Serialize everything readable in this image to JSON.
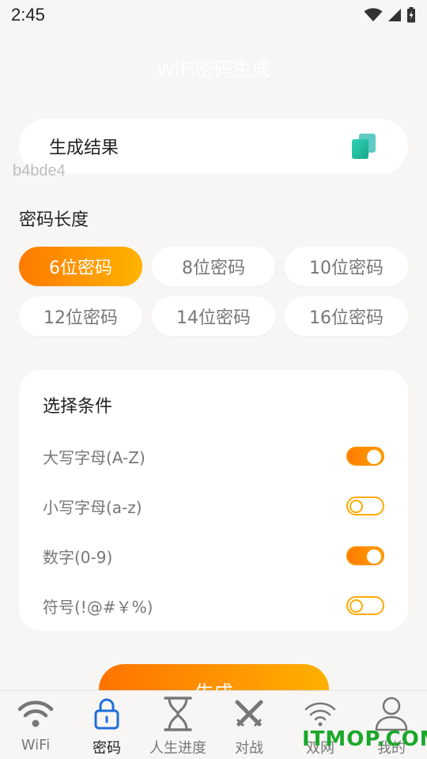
{
  "status_bar": {
    "time": "2:45",
    "icons": [
      "wifi-icon",
      "signal-icon",
      "battery-icon"
    ]
  },
  "header": {
    "title": "WiFi密码生成"
  },
  "result": {
    "label": "生成结果",
    "value": "b4bde4",
    "copy_icon": "copy-icon"
  },
  "length_section": {
    "label": "密码长度",
    "options": [
      {
        "label": "6位密码",
        "selected": true
      },
      {
        "label": "8位密码",
        "selected": false
      },
      {
        "label": "10位密码",
        "selected": false
      },
      {
        "label": "12位密码",
        "selected": false
      },
      {
        "label": "14位密码",
        "selected": false
      },
      {
        "label": "16位密码",
        "selected": false
      }
    ]
  },
  "conditions": {
    "title": "选择条件",
    "items": [
      {
        "label": "大写字母(A-Z)",
        "enabled": true
      },
      {
        "label": "小写字母(a-z)",
        "enabled": false
      },
      {
        "label": "数字(0-9)",
        "enabled": true
      },
      {
        "label": "符号(!@#￥%)",
        "enabled": false
      }
    ]
  },
  "generate_button": {
    "label": "生成"
  },
  "tabbar": {
    "tabs": [
      {
        "label": "WiFi",
        "icon": "wifi-icon",
        "active": false
      },
      {
        "label": "密码",
        "icon": "lock-icon",
        "active": true
      },
      {
        "label": "人生进度",
        "icon": "hourglass-icon",
        "active": false
      },
      {
        "label": "对战",
        "icon": "crossed-swords-icon",
        "active": false
      },
      {
        "label": "双网",
        "icon": "wifi-icon",
        "active": false
      },
      {
        "label": "我的",
        "icon": "user-icon",
        "active": false
      }
    ]
  },
  "watermark": {
    "text": "ITMOP.COM"
  },
  "colors": {
    "accent_start": "#ff7a00",
    "accent_end": "#ffb300",
    "active_tab": "#1f6fd6",
    "background": "#f7f6f4"
  }
}
